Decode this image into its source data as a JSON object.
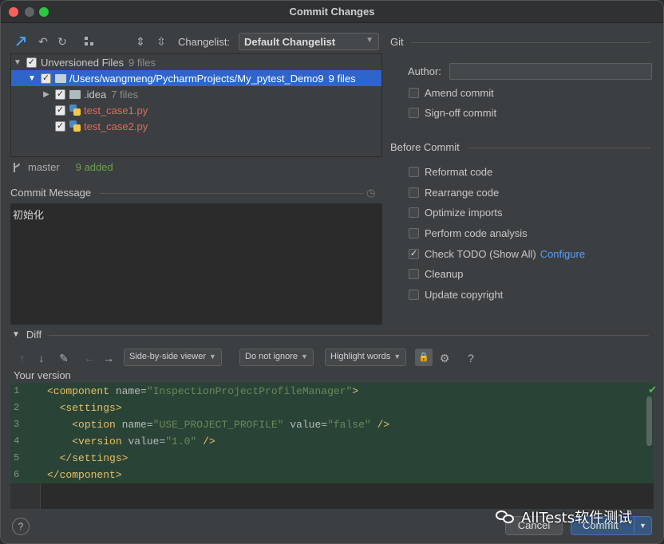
{
  "window": {
    "title": "Commit Changes"
  },
  "toolbar": {
    "icons": [
      "show-diff-icon",
      "rollback-icon",
      "refresh-icon",
      "group-by-icon",
      "expand-all-icon",
      "collapse-all-icon"
    ],
    "changelist_label": "Changelist:",
    "changelist_value": "Default Changelist"
  },
  "tree": {
    "root_label": "Unversioned Files",
    "root_count": "9 files",
    "project_path": "/Users/wangmeng/PycharmProjects/My_pytest_Demo9",
    "project_count": "9 files",
    "idea_label": ".idea",
    "idea_count": "7 files",
    "file1": "test_case1.py",
    "file2": "test_case2.py"
  },
  "branch": {
    "name": "master",
    "status": "9 added"
  },
  "commit_message": {
    "label": "Commit Message",
    "value": "初始化"
  },
  "git": {
    "title": "Git",
    "author_label": "Author:",
    "author_value": "",
    "amend": "Amend commit",
    "signoff": "Sign-off commit"
  },
  "before_commit": {
    "title": "Before Commit",
    "options": [
      {
        "label": "Reformat code",
        "checked": false
      },
      {
        "label": "Rearrange code",
        "checked": false
      },
      {
        "label": "Optimize imports",
        "checked": false
      },
      {
        "label": "Perform code analysis",
        "checked": false
      },
      {
        "label": "Check TODO (Show All)",
        "checked": true,
        "link": "Configure"
      },
      {
        "label": "Cleanup",
        "checked": false
      },
      {
        "label": "Update copyright",
        "checked": false
      }
    ]
  },
  "diff": {
    "title": "Diff",
    "viewer": "Side-by-side viewer",
    "ignore": "Do not ignore",
    "highlight": "Highlight words",
    "help": "?",
    "your_version": "Your version",
    "lines": [
      {
        "n": "1"
      },
      {
        "n": "2"
      },
      {
        "n": "3"
      },
      {
        "n": "4"
      },
      {
        "n": "5"
      },
      {
        "n": "6"
      }
    ],
    "code": {
      "l1_tag": "<component",
      "l1_attr": " name=",
      "l1_val": "\"InspectionProjectProfileManager\"",
      "l1_end": ">",
      "l2": "<settings>",
      "l3_tag": "<option",
      "l3_attr1": " name=",
      "l3_val1": "\"USE_PROJECT_PROFILE\"",
      "l3_attr2": " value=",
      "l3_val2": "\"false\"",
      "l3_end": " />",
      "l4_tag": "<version",
      "l4_attr": " value=",
      "l4_val": "\"1.0\"",
      "l4_end": " />",
      "l5": "</settings>",
      "l6": "</component>"
    }
  },
  "buttons": {
    "cancel": "Cancel",
    "commit": "Commit",
    "help": "?"
  },
  "watermark": "AllTests软件测试",
  "colors": {
    "selection": "#2f65ca",
    "added_bg": "#294436",
    "link": "#589df6",
    "unversioned": "#e06c5a"
  }
}
